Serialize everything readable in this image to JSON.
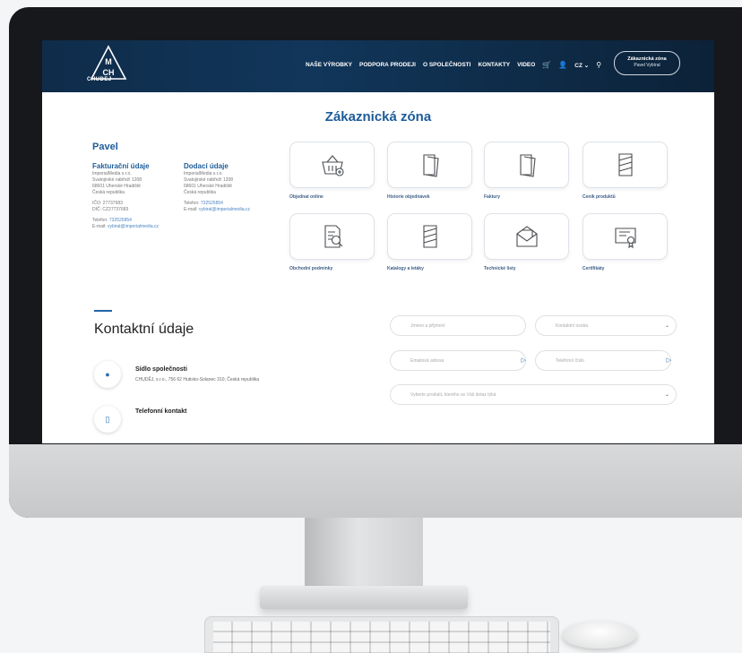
{
  "header": {
    "logo_text": "CHUDEJ",
    "logo_letters": "MCH",
    "nav": [
      "NAŠE VÝROBKY",
      "PODPORA PRODEJI",
      "O SPOLEČNOSTI",
      "KONTAKTY",
      "VIDEO"
    ],
    "lang": "CZ",
    "zone_title": "Zákaznická zóna",
    "zone_user": "Pavel Vybíral"
  },
  "page": {
    "title": "Zákaznická zóna",
    "user_name": "Pavel"
  },
  "billing": {
    "heading": "Fakturační údaje",
    "lines": [
      "ImperialMedia s.r.o.",
      "Svatojirské nábřeží 1208",
      "68601 Uherské Hradiště",
      "Česká republika"
    ],
    "ico": "IČO: 27737683",
    "dic": "DIČ: CZ27737683",
    "phone_label": "Telefon:",
    "phone": "732525854",
    "email_label": "E-mail:",
    "email": "vybiral@imperialmedia.cz"
  },
  "delivery": {
    "heading": "Dodací údaje",
    "lines": [
      "ImperialMedia s.r.o.",
      "Svatojirské nábřeží 1208",
      "68601 Uherské Hradiště",
      "Česká republika"
    ],
    "phone_label": "Telefon:",
    "phone": "732525854",
    "email_label": "E-mail:",
    "email": "vybiral@imperialmedia.cz"
  },
  "tiles": [
    {
      "label": "Objednat online",
      "icon": "basket-icon"
    },
    {
      "label": "Historie objednávek",
      "icon": "documents-icon"
    },
    {
      "label": "Faktury",
      "icon": "documents-icon"
    },
    {
      "label": "Ceník produktů",
      "icon": "leaflet-icon"
    },
    {
      "label": "Obchodní podmínky",
      "icon": "document-search-icon"
    },
    {
      "label": "Katalogy a letáky",
      "icon": "leaflet-icon"
    },
    {
      "label": "Technické listy",
      "icon": "envelope-icon"
    },
    {
      "label": "Certifikáty",
      "icon": "certificate-icon"
    }
  ],
  "contact": {
    "title": "Kontaktní údaje",
    "items": [
      {
        "title": "Sídlo společnosti",
        "text": "CHUDĚJ, s.r.o., 756 62 Hutisko-Solanec 310, Česká republika",
        "icon": "location-pin-icon"
      },
      {
        "title": "Telefonní kontakt",
        "text": "",
        "icon": "phone-icon"
      }
    ]
  },
  "form": {
    "name_placeholder": "Jméno a příjmení",
    "contact_person": "Kontaktní osoba",
    "email_placeholder": "Emailová adresa",
    "phone_placeholder": "Telefonní číslo",
    "product_select": "Vyberte produkt, kterého se Váš dotaz týká"
  }
}
